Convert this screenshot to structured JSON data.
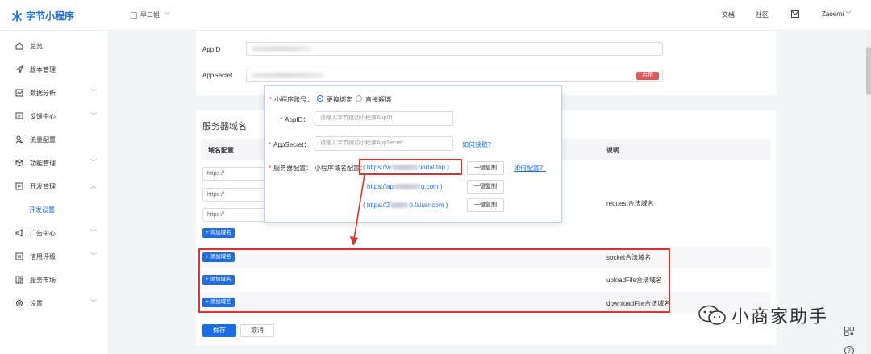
{
  "app": {
    "logo_text": "字节小程序",
    "project_name": "早二姐"
  },
  "topnav": {
    "docs": "文档",
    "community": "社区",
    "user": "Zaoerni"
  },
  "sidebar": {
    "items": [
      {
        "label": "总览"
      },
      {
        "label": "版本管理"
      },
      {
        "label": "数据分析"
      },
      {
        "label": "反馈中心"
      },
      {
        "label": "流量配置"
      },
      {
        "label": "功能管理"
      },
      {
        "label": "开发管理"
      },
      {
        "label": "开发设置"
      },
      {
        "label": "广告中心"
      },
      {
        "label": "信用评级"
      },
      {
        "label": "服务市场"
      },
      {
        "label": "设置"
      }
    ]
  },
  "form": {
    "appid_label": "AppID",
    "appsecret_label": "AppSecret",
    "enable_button": "启用"
  },
  "server_domain": {
    "title": "服务器域名",
    "columns": {
      "config": "域名配置",
      "desc": "说明"
    },
    "protocol": "https://",
    "add_button": "+ 添加域名",
    "descriptions": {
      "request": "request合法域名",
      "socket": "socket合法域名",
      "uploadfile": "uploadFile合法域名",
      "downloadfile": "downloadFile合法域名"
    }
  },
  "actions": {
    "save": "保存",
    "cancel": "取消"
  },
  "popup": {
    "account_label": "小程序账号：",
    "radio_change": "更换绑定",
    "radio_unbind": "直接解绑",
    "appid_label": "AppID：",
    "appid_placeholder": "请输入字节跳动小程序AppID",
    "appsecret_label": "AppSecret：",
    "appsecret_placeholder": "请输入字节跳动小程序AppSecret",
    "how_get": "如何获取？",
    "server_label": "服务器配置：",
    "domain_label": "小程序域名配置：",
    "domain1_pre": "( https://w",
    "domain1_post": "portal.top )",
    "domain2_pre": "https://ap",
    "domain2_post": "g.com )",
    "domain3_pre": "( https://2",
    "domain3_post": "0.faiusr.com )",
    "copy": "一键复制",
    "how_config": "如何配置？"
  },
  "watermark": "小商家助手",
  "colors": {
    "brand": "#1f6de6",
    "highlight": "#e03030",
    "enable": "#e85656"
  }
}
